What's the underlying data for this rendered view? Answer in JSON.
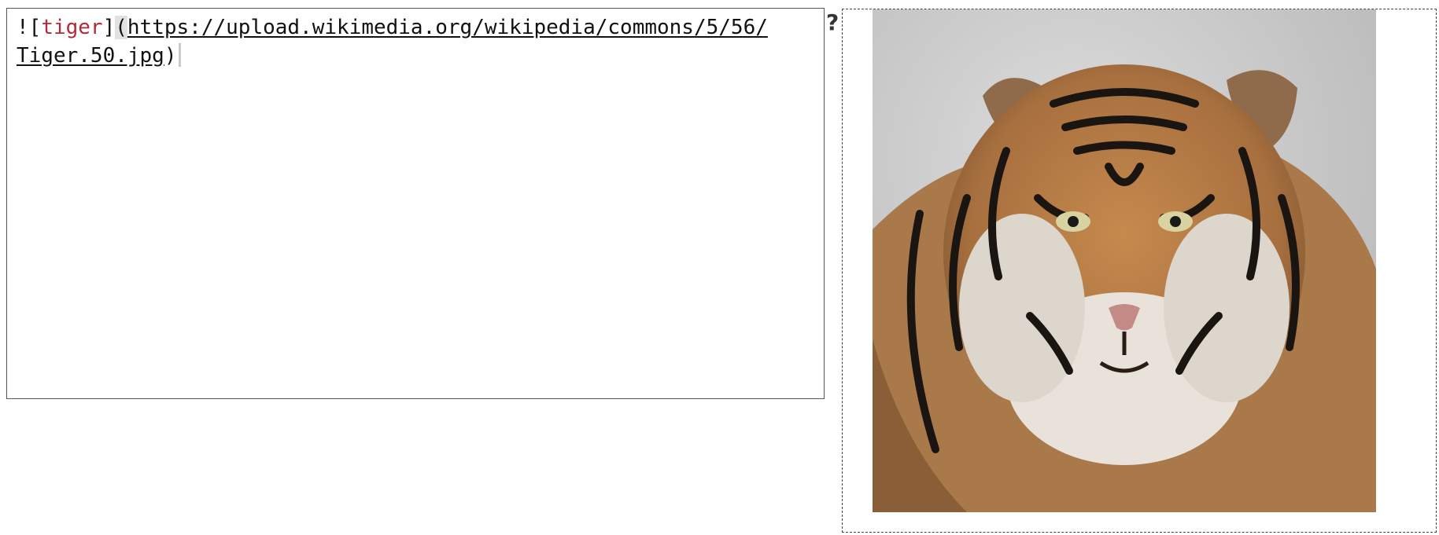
{
  "editor": {
    "line1": {
      "bang": "!",
      "open_bracket": "[",
      "alt_text": "tiger",
      "close_bracket": "]",
      "open_paren": "(",
      "url_line1": "https://upload.wikimedia.org/wikipedia/commons/5/56/"
    },
    "line2": {
      "url_line2": "Tiger.50.jpg",
      "close_paren": ")"
    }
  },
  "help_button": {
    "label": "?"
  },
  "preview": {
    "image_alt": "tiger",
    "image_src_text": "https://upload.wikimedia.org/wikipedia/commons/5/56/Tiger.50.jpg"
  },
  "colors": {
    "alt_text": "#b22a3a",
    "paren_highlight": "#e2e2e2"
  }
}
